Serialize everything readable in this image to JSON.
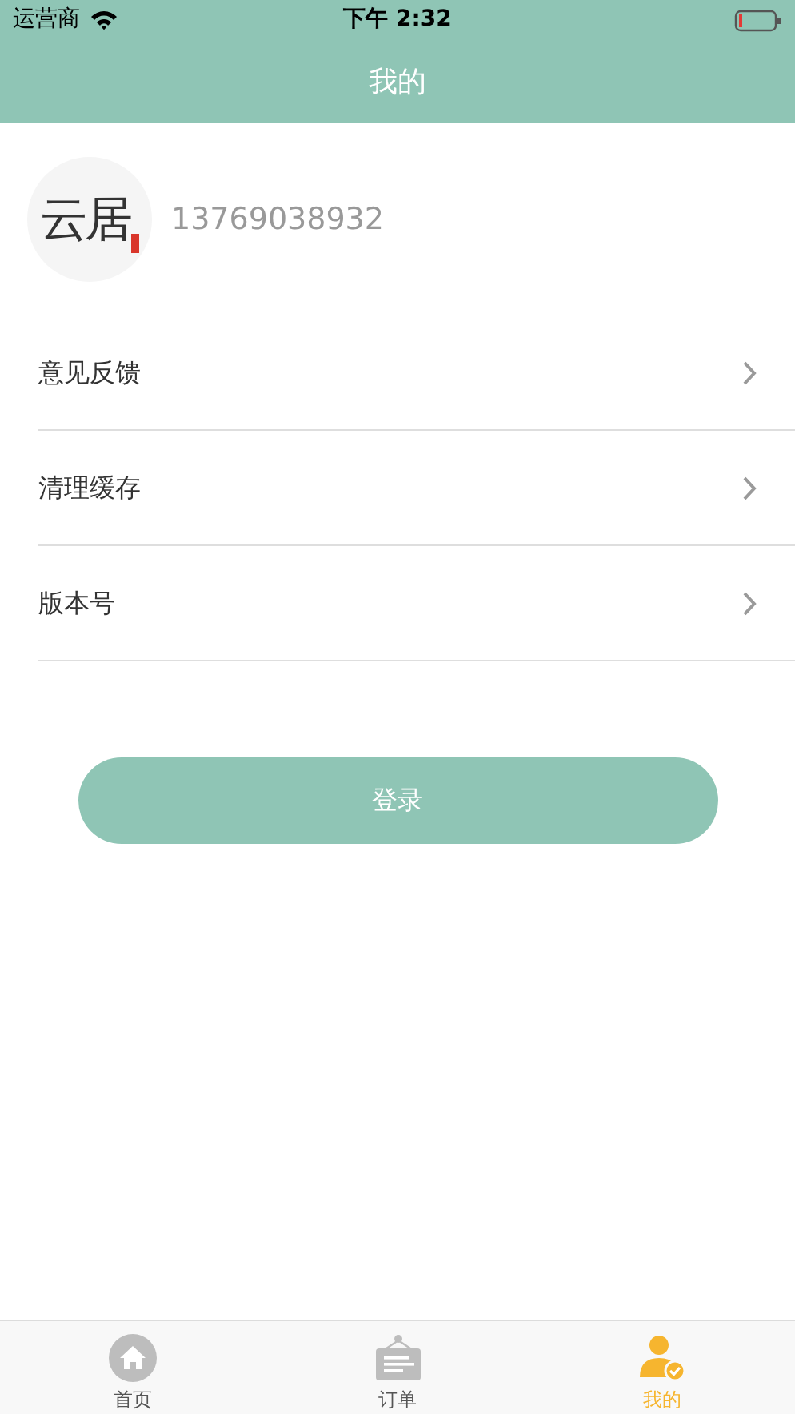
{
  "status_bar": {
    "carrier": "运营商",
    "time": "下午 2:32"
  },
  "nav_bar": {
    "title": "我的"
  },
  "profile": {
    "logo_text": "云居",
    "phone": "13769038932"
  },
  "menu": [
    {
      "label": "意见反馈"
    },
    {
      "label": "清理缓存"
    },
    {
      "label": "版本号"
    }
  ],
  "login_button": "登录",
  "tab_bar": [
    {
      "label": "首页",
      "kind": "home",
      "selected": false
    },
    {
      "label": "订单",
      "kind": "orders",
      "selected": false
    },
    {
      "label": "我的",
      "kind": "profile",
      "selected": true
    }
  ]
}
